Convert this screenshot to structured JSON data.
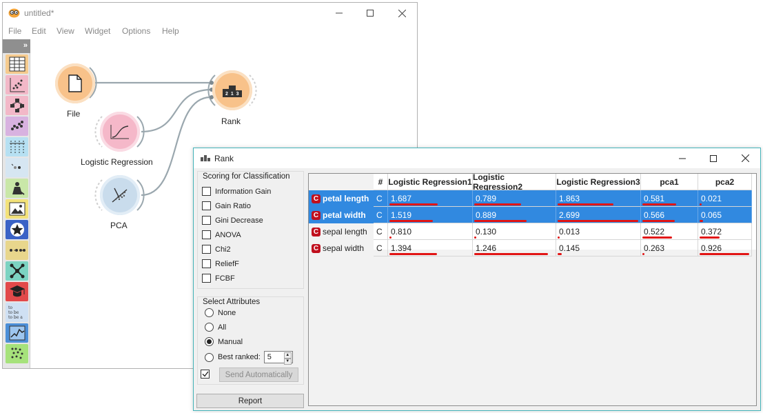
{
  "main_window": {
    "title": "untitled*",
    "menu": [
      "File",
      "Edit",
      "View",
      "Widget",
      "Options",
      "Help"
    ],
    "toolbox_toggle": "»",
    "toolbox_icons": [
      "data-table-icon",
      "scatter-plot-icon",
      "tree-icon",
      "clustering-icon",
      "distribution-icon",
      "preprocess-icon",
      "explore-icon",
      "image-icon",
      "star-icon",
      "network-icon",
      "network-graph-icon",
      "education-icon",
      "text-mining-icon",
      "time-series-icon",
      "single-cell-icon"
    ],
    "text_tool_lines": [
      "to",
      "to be",
      "to be a"
    ],
    "nodes": {
      "file": "File",
      "logistic_regression": "Logistic Regression",
      "pca": "PCA",
      "rank": "Rank"
    },
    "rank_node_digits": "2 1 3"
  },
  "rank_dialog": {
    "title": "Rank",
    "scoring_title": "Scoring for Classification",
    "scorers": [
      {
        "label": "Information Gain",
        "checked": false
      },
      {
        "label": "Gain Ratio",
        "checked": false
      },
      {
        "label": "Gini Decrease",
        "checked": false
      },
      {
        "label": "ANOVA",
        "checked": false
      },
      {
        "label": "Chi2",
        "checked": false
      },
      {
        "label": "ReliefF",
        "checked": false
      },
      {
        "label": "FCBF",
        "checked": false
      }
    ],
    "select_title": "Select Attributes",
    "select_options": [
      {
        "label": "None",
        "selected": false
      },
      {
        "label": "All",
        "selected": false
      },
      {
        "label": "Manual",
        "selected": true
      },
      {
        "label": "Best ranked:",
        "selected": false
      }
    ],
    "best_ranked_value": "5",
    "send_auto_checked": true,
    "send_button": "Send Automatically",
    "report_button": "Report",
    "table": {
      "columns": [
        "#",
        "Logistic Regression1",
        "Logistic Regression2",
        "Logistic Regression3",
        "pca1",
        "pca2"
      ],
      "rows": [
        {
          "name": "petal length",
          "badge": "C",
          "type": "C",
          "values": [
            "1.687",
            "0.789",
            "1.863",
            "0.581",
            "0.021"
          ],
          "fractions": [
            0.6,
            0.59,
            0.69,
            0.63,
            0.02
          ],
          "selected": true
        },
        {
          "name": "petal width",
          "badge": "C",
          "type": "C",
          "values": [
            "1.519",
            "0.889",
            "2.699",
            "0.566",
            "0.065"
          ],
          "fractions": [
            0.54,
            0.66,
            1.0,
            0.61,
            0.07
          ],
          "selected": true
        },
        {
          "name": "sepal length",
          "badge": "C",
          "type": "C",
          "values": [
            "0.810",
            "0.130",
            "0.013",
            "0.522",
            "0.372"
          ],
          "fractions": [
            0.01,
            0.01,
            0.01,
            0.56,
            0.4
          ],
          "selected": false
        },
        {
          "name": "sepal width",
          "badge": "C",
          "type": "C",
          "values": [
            "1.394",
            "1.246",
            "0.145",
            "0.263",
            "0.926"
          ],
          "fractions": [
            0.59,
            0.93,
            0.05,
            0.01,
            1.0
          ],
          "selected": false
        }
      ]
    }
  },
  "colors": {
    "selection": "#3189e0",
    "bar": "#e21414",
    "dialog_border": "#41b2b8",
    "file_node": "#f8c28a",
    "lr_node": "#f5b8c9",
    "pca_node": "#c9dcec",
    "rank_node": "#f8c28a"
  }
}
